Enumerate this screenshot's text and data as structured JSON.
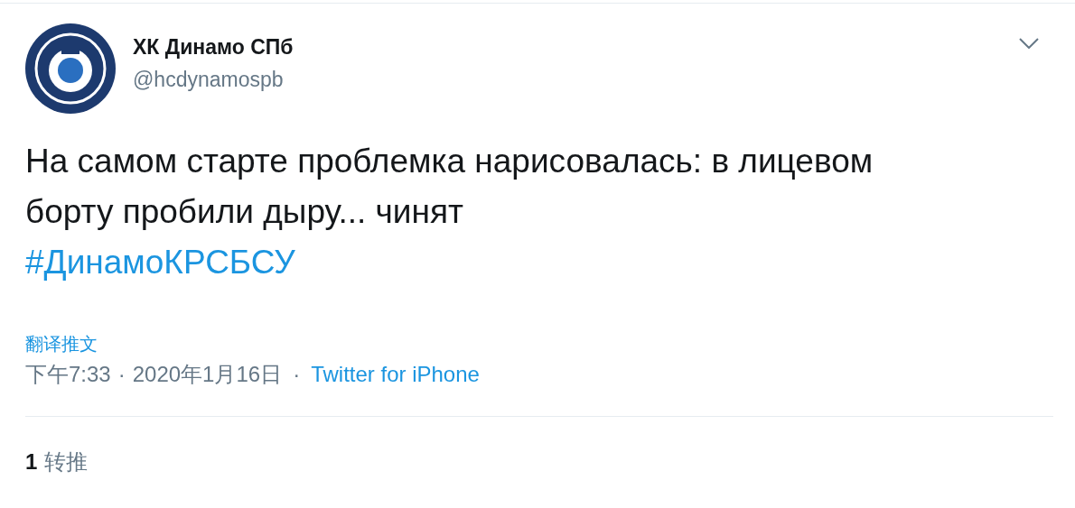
{
  "author": {
    "name": "ХК Динамо СПб",
    "handle": "@hcdynamospb"
  },
  "tweet": {
    "text": "На самом старте проблемка нарисовалась: в лицевом борту пробили дыру... чинят",
    "hashtag": "#ДинамоКРСБСУ"
  },
  "translate_link": "翻译推文",
  "meta": {
    "time": "下午7:33",
    "separator": "·",
    "date": "2020年1月16日",
    "separator_2": "·",
    "source": "Twitter for iPhone"
  },
  "stats": [
    {
      "count": "1",
      "label": "转推"
    }
  ]
}
